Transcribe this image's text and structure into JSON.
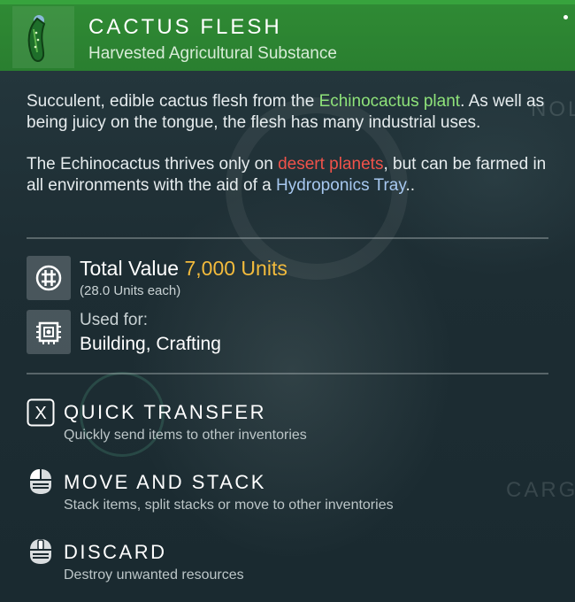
{
  "item": {
    "name": "CACTUS FLESH",
    "category": "Harvested Agricultural Substance",
    "icon": "cactus-flesh-icon"
  },
  "description": {
    "p1_a": "Succulent, edible cactus flesh from the ",
    "p1_link": "Echinocactus plant",
    "p1_b": ". As well as being juicy on the tongue, the flesh has many industrial uses.",
    "p2_a": "The Echinocactus thrives only on ",
    "p2_red": "desert planets",
    "p2_b": ", but can be farmed in all environments with the aid of a ",
    "p2_blue": "Hydroponics Tray",
    "p2_c": ".."
  },
  "value": {
    "label": "Total Value",
    "amount": "7,000 Units",
    "each": "(28.0 Units each)"
  },
  "usage": {
    "label": "Used for:",
    "value": "Building, Crafting"
  },
  "actions": [
    {
      "key": "X",
      "title": "QUICK TRANSFER",
      "desc": "Quickly send items to other inventories"
    },
    {
      "title": "MOVE AND STACK",
      "desc": "Stack items, split stacks or move to other inventories"
    },
    {
      "title": "DISCARD",
      "desc": "Destroy unwanted resources"
    }
  ],
  "background": {
    "word1": "NOL",
    "word2": "CARGO"
  },
  "colors": {
    "header": "#2f8a34",
    "highlight_green": "#8fe37a",
    "highlight_red": "#f0524a",
    "highlight_blue": "#a7c8f0",
    "units_gold": "#f3bb3c"
  }
}
